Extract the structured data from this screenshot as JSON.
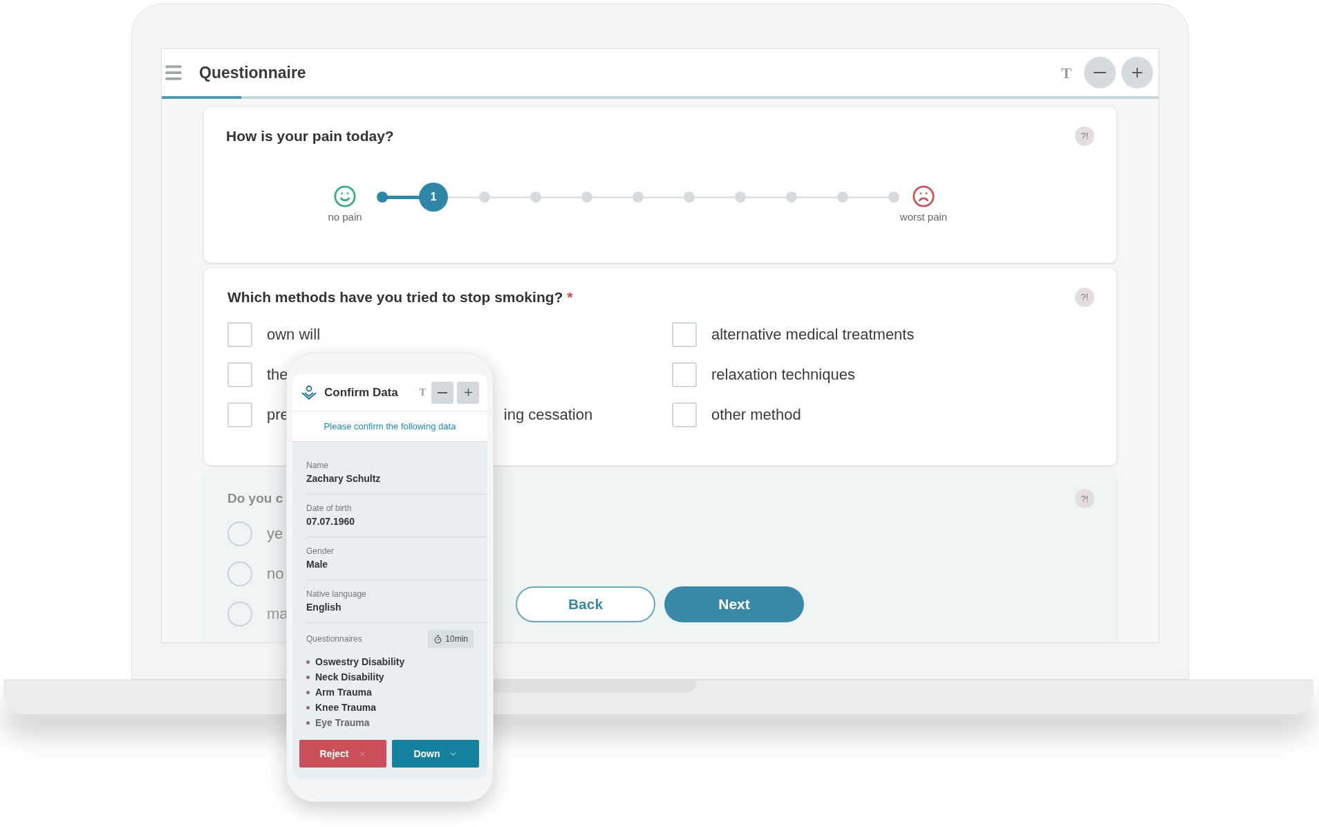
{
  "header": {
    "title": "Questionnaire",
    "font_size_label": "T",
    "progress": {
      "level": 0.08
    }
  },
  "pain_question": {
    "title": "How is your pain today?",
    "help": "?!",
    "min_label": "no pain",
    "max_label": "worst pain",
    "value": "1",
    "points": [
      {
        "selected": false
      },
      {
        "selected": true
      },
      {
        "selected": false
      },
      {
        "selected": false
      },
      {
        "selected": false
      },
      {
        "selected": false
      },
      {
        "selected": false
      },
      {
        "selected": false
      },
      {
        "selected": false
      },
      {
        "selected": false
      },
      {
        "selected": false
      }
    ]
  },
  "smoking_question": {
    "title": "Which methods have you tried to stop smoking?",
    "required_mark": "*",
    "help": "?!",
    "columns": [
      [
        {
          "label": "own will",
          "checked": false
        },
        {
          "label": "the",
          "checked": false
        },
        {
          "label": "pre",
          "label_tail": "ing cessation",
          "checked": false
        }
      ],
      [
        {
          "label": "alternative medical treatments",
          "checked": false
        },
        {
          "label": "relaxation techniques",
          "checked": false
        },
        {
          "label": "other method",
          "checked": false
        }
      ]
    ]
  },
  "third_question": {
    "title": "Do you c",
    "help": "?!",
    "options": [
      {
        "label": "ye",
        "selected": false
      },
      {
        "label": "no",
        "selected": false
      },
      {
        "label": "ma",
        "selected": false
      }
    ]
  },
  "nav_buttons": {
    "back": "Back",
    "next": "Next"
  },
  "phone": {
    "title": "Confirm Data",
    "font_size_label": "T",
    "subtitle": "Please confirm the following data",
    "fields": [
      {
        "label": "Name",
        "value": "Zachary Schultz"
      },
      {
        "label": "Date of birth",
        "value": "07.07.1960"
      },
      {
        "label": "Gender",
        "value": "Male"
      },
      {
        "label": "Native language",
        "value": "English"
      }
    ],
    "questionnaires_label": "Questionnaires",
    "duration": "10min",
    "questionnaires": [
      "Oswestry Disability",
      "Neck Disability",
      "Arm Trauma",
      "Knee Trauma",
      "Eye Trauma"
    ],
    "reject": "Reject",
    "down": "Down"
  }
}
